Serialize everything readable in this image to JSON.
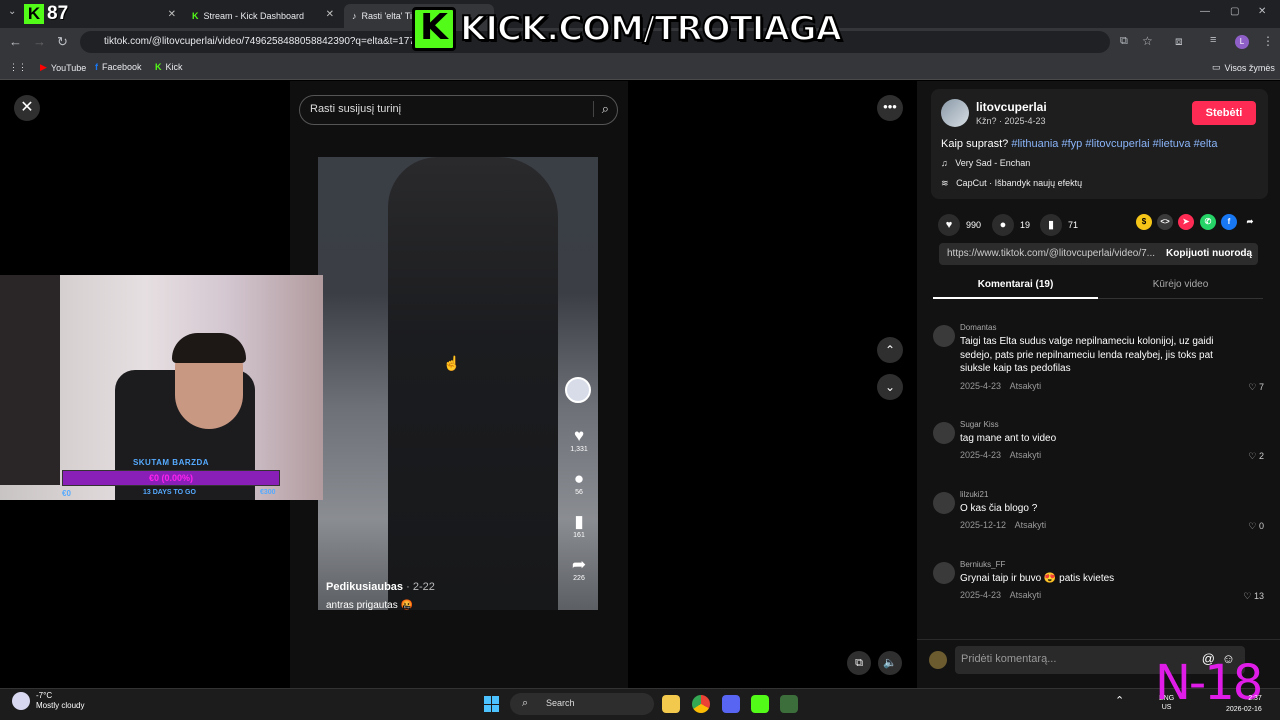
{
  "browser": {
    "tabs": [
      {
        "label": "",
        "active": false
      },
      {
        "label": "Stream - Kick Dashboard",
        "active": false
      },
      {
        "label": "Rasti 'elta' Ti",
        "active": true
      }
    ],
    "url": "tiktok.com/@litovcuperlai/video/7496258488058842390?q=elta&t=17712",
    "bookmarks": [
      "YouTube",
      "Facebook",
      "Kick"
    ],
    "all_bookmarks": "Visos žymės"
  },
  "overlay": {
    "viewer_count": "87",
    "kick_logo": "K",
    "banner_text": "KICK.COM/TROTIAGA",
    "n18": "N-18",
    "webcam_goal": {
      "title": "SKUTAM BARZDA",
      "progress_text": "€0 (0.00%)",
      "progress": 0.0,
      "left": "€0",
      "middle": "13 DAYS TO GO",
      "right": "€300"
    }
  },
  "tiktok": {
    "search_placeholder": "Rasti susijusį turinį",
    "video": {
      "author": "Pedikusiaubas",
      "date": "· 2-22",
      "caption": "antras prigautas 🤬",
      "likes": "1,331",
      "comments": "56",
      "saves": "161",
      "shares": "226"
    },
    "post": {
      "username": "litovcuperlai",
      "subinfo": "Kžn? · 2025-4-23",
      "follow_label": "Stebėti",
      "description_prefix": "Kaip suprast?",
      "hashtags": [
        "#lithuania",
        "#fyp",
        "#litovcuperlai",
        "#lietuva",
        "#elta"
      ],
      "music": "Very Sad - Enchan",
      "capcut": "CapCut · Išbandyk naujų efektų",
      "likes": "990",
      "comments": "19",
      "saves": "71",
      "link": "https://www.tiktok.com/@litovcuperlai/video/7...",
      "copy_label": "Kopijuoti nuorodą"
    },
    "tabs": {
      "comments": "Komentarai (19)",
      "creator_videos": "Kūrėjo video"
    },
    "comments": [
      {
        "name": "Domantas",
        "text": "Taigi tas Elta sudus valge nepilnameciu kolonijoj, uz gaidi sedejo, pats prie nepilnameciu lenda realybej, jis toks pat siuksle kaip tas pedofilas",
        "date": "2025-4-23",
        "reply": "Atsakyti",
        "likes": "7"
      },
      {
        "name": "Sugar Kiss",
        "text": "tag mane ant to video",
        "date": "2025-4-23",
        "reply": "Atsakyti",
        "likes": "2"
      },
      {
        "name": "lilzuki21",
        "text": "O kas čia blogo ?",
        "date": "2025-12-12",
        "reply": "Atsakyti",
        "likes": "0"
      },
      {
        "name": "Berniuks_FF",
        "text": "Grynai taip ir buvo 😍 patis kvietes",
        "date": "2025-4-23",
        "reply": "Atsakyti",
        "likes": "13"
      }
    ],
    "comment_placeholder": "Pridėti komentarą..."
  },
  "taskbar": {
    "weather_temp": "-7°C",
    "weather_desc": "Mostly cloudy",
    "search_label": "Search",
    "lang_line1": "ENG",
    "lang_line2": "US",
    "time": "2:37",
    "date": "2026-02-16"
  }
}
